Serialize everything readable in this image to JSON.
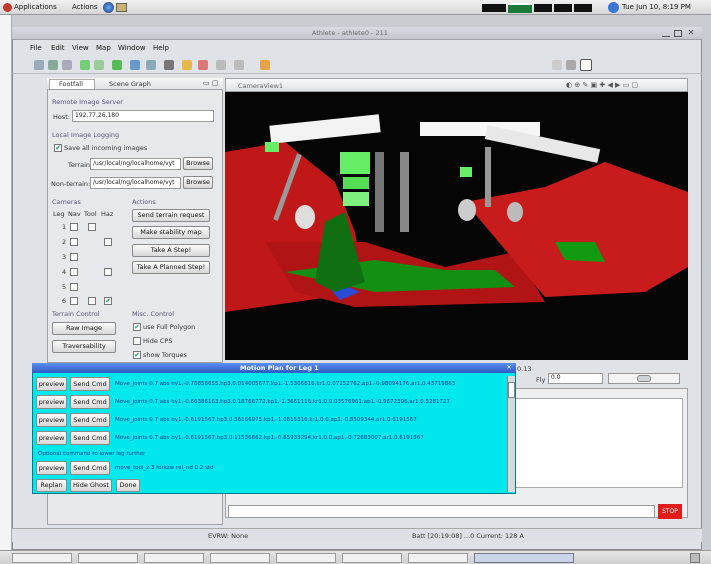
{
  "desktop": {
    "applications_label": "Applications",
    "actions_label": "Actions",
    "clock": "Tue Jun 10, 8:19 PM"
  },
  "window": {
    "title": "Athlete - athlete0 - 211"
  },
  "menu": [
    "File",
    "Edit",
    "View",
    "Map",
    "Window",
    "Help"
  ],
  "tabs": {
    "left": [
      "Footfall",
      "Scene Graph"
    ],
    "camera": "CameraView1"
  },
  "remote": {
    "section": "Remote Image Server",
    "host_label": "Host:",
    "host_value": "192.77.26.180"
  },
  "logging": {
    "section": "Local Image Logging",
    "save_label": "Save all incoming images",
    "save_checked": true,
    "terrain_label": "Terrain:",
    "terrain_value": "/usr/local/ng/localhome/vyt",
    "nonterrain_label": "Non-terrain:",
    "nonterrain_value": "/usr/local/ng/localhome/vyt",
    "browse_label": "Browse"
  },
  "cameras": {
    "section": "Cameras",
    "headers": [
      "Leg",
      "Nav",
      "Tool",
      "Haz"
    ],
    "rows": [
      {
        "leg": "1",
        "haz_checked": false
      },
      {
        "leg": "2",
        "haz_checked": false
      },
      {
        "leg": "3",
        "haz_checked": false
      },
      {
        "leg": "4",
        "haz_checked": false
      },
      {
        "leg": "5",
        "haz_checked": false
      },
      {
        "leg": "6",
        "haz_checked": true
      }
    ]
  },
  "actions": {
    "section": "Actions",
    "buttons": [
      "Send terrain request",
      "Make stability map",
      "Take A Step!",
      "Take A Planned Step!"
    ]
  },
  "terrain_control": {
    "section": "Terrain Control",
    "buttons": [
      "Raw Image",
      "Traversability"
    ]
  },
  "misc": {
    "section": "Misc. Control",
    "items": [
      {
        "label": "use Full Polygon",
        "checked": true
      },
      {
        "label": "Hide CPS",
        "checked": false
      },
      {
        "label": "show Torques",
        "checked": true
      }
    ]
  },
  "camera_controls": {
    "value_label": "0.13",
    "fly_label": "Fly",
    "fly_value": "0.0"
  },
  "motion_plan": {
    "title": "Motion Plan for Leg 1",
    "preview_label": "preview",
    "send_label": "Send Cmd",
    "rows": [
      "Move_Joints 0.7 abs hy1,-0.70856655,hp3,0.014005677,kp1,-1.5306816,kr1,0.07152762,ap1,-0.98094176,ar1,0.43719863",
      "Move_Joints 0.7 abs hy1,-0.66386163,hp3,0.18766772,kp1,-1.3661116,kr1,0.0.03576961,ap1,-0.9672396,ar1,0.5281727",
      "Move_Joints 0.7 abs hy1,-0.6191567,hp3,0.36166975,kp1,-1.0815316,kr1,0.0,ap1,-0.8509344,ar1,0.6191567",
      "Move_Joints 0.7 abs hy1,-0.6191567,hp3,0.11536662,kp1,-0.85933294,kr1,0.0,ap1,-0.72683007,ar1,0.6191567"
    ],
    "optional_label": "Optional command to lower leg further",
    "tool_command": "move_tool_z  3 forkzw rel_nd 0.2 std",
    "replan_label": "Replan",
    "hide_ghost_label": "Hide Ghost",
    "done_label": "Done"
  },
  "console": {
    "stop_label": "STOP"
  },
  "status_bar": {
    "evrw": "EVRW: None",
    "batt": "Batt [20:19:08] ...0 Current: 128 A"
  },
  "colors": {
    "terrain_red": "#c01818",
    "robot_green": "#66ee66",
    "motion_plan_bg": "#00e8ee",
    "titlebar_blue": "#3f6fd0"
  }
}
